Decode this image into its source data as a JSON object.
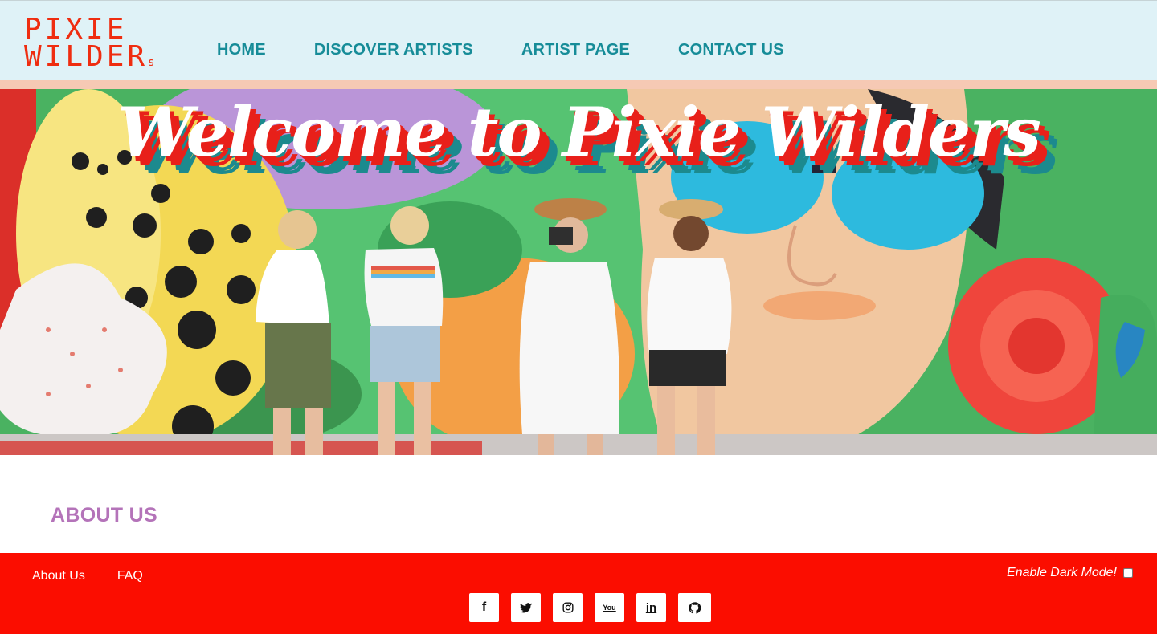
{
  "header": {
    "logo": {
      "line1": "PIXIE",
      "line2": "WILDER",
      "suffix": "s"
    },
    "nav": [
      {
        "label": "HOME"
      },
      {
        "label": "DISCOVER ARTISTS"
      },
      {
        "label": "ARTIST PAGE"
      },
      {
        "label": "CONTACT US"
      }
    ]
  },
  "hero": {
    "title": "Welcome to Pixie Wilders"
  },
  "about": {
    "title": "ABOUT US"
  },
  "footer": {
    "links": [
      {
        "label": "About Us"
      },
      {
        "label": "FAQ"
      }
    ],
    "dark_mode_label": "Enable Dark Mode!",
    "dark_mode_checked": false,
    "socials": [
      {
        "icon": "facebook-icon",
        "glyph": "f"
      },
      {
        "icon": "twitter-icon",
        "glyph": ""
      },
      {
        "icon": "instagram-icon",
        "glyph": ""
      },
      {
        "icon": "youtube-icon",
        "glyph": "You"
      },
      {
        "icon": "linkedin-icon",
        "glyph": "in"
      },
      {
        "icon": "github-icon",
        "glyph": ""
      }
    ]
  },
  "colors": {
    "header_bg": "#dff2f7",
    "nav_text": "#168c98",
    "logo": "#ef2d10",
    "about_title": "#b473b9",
    "footer_bg": "#fb0d00"
  }
}
